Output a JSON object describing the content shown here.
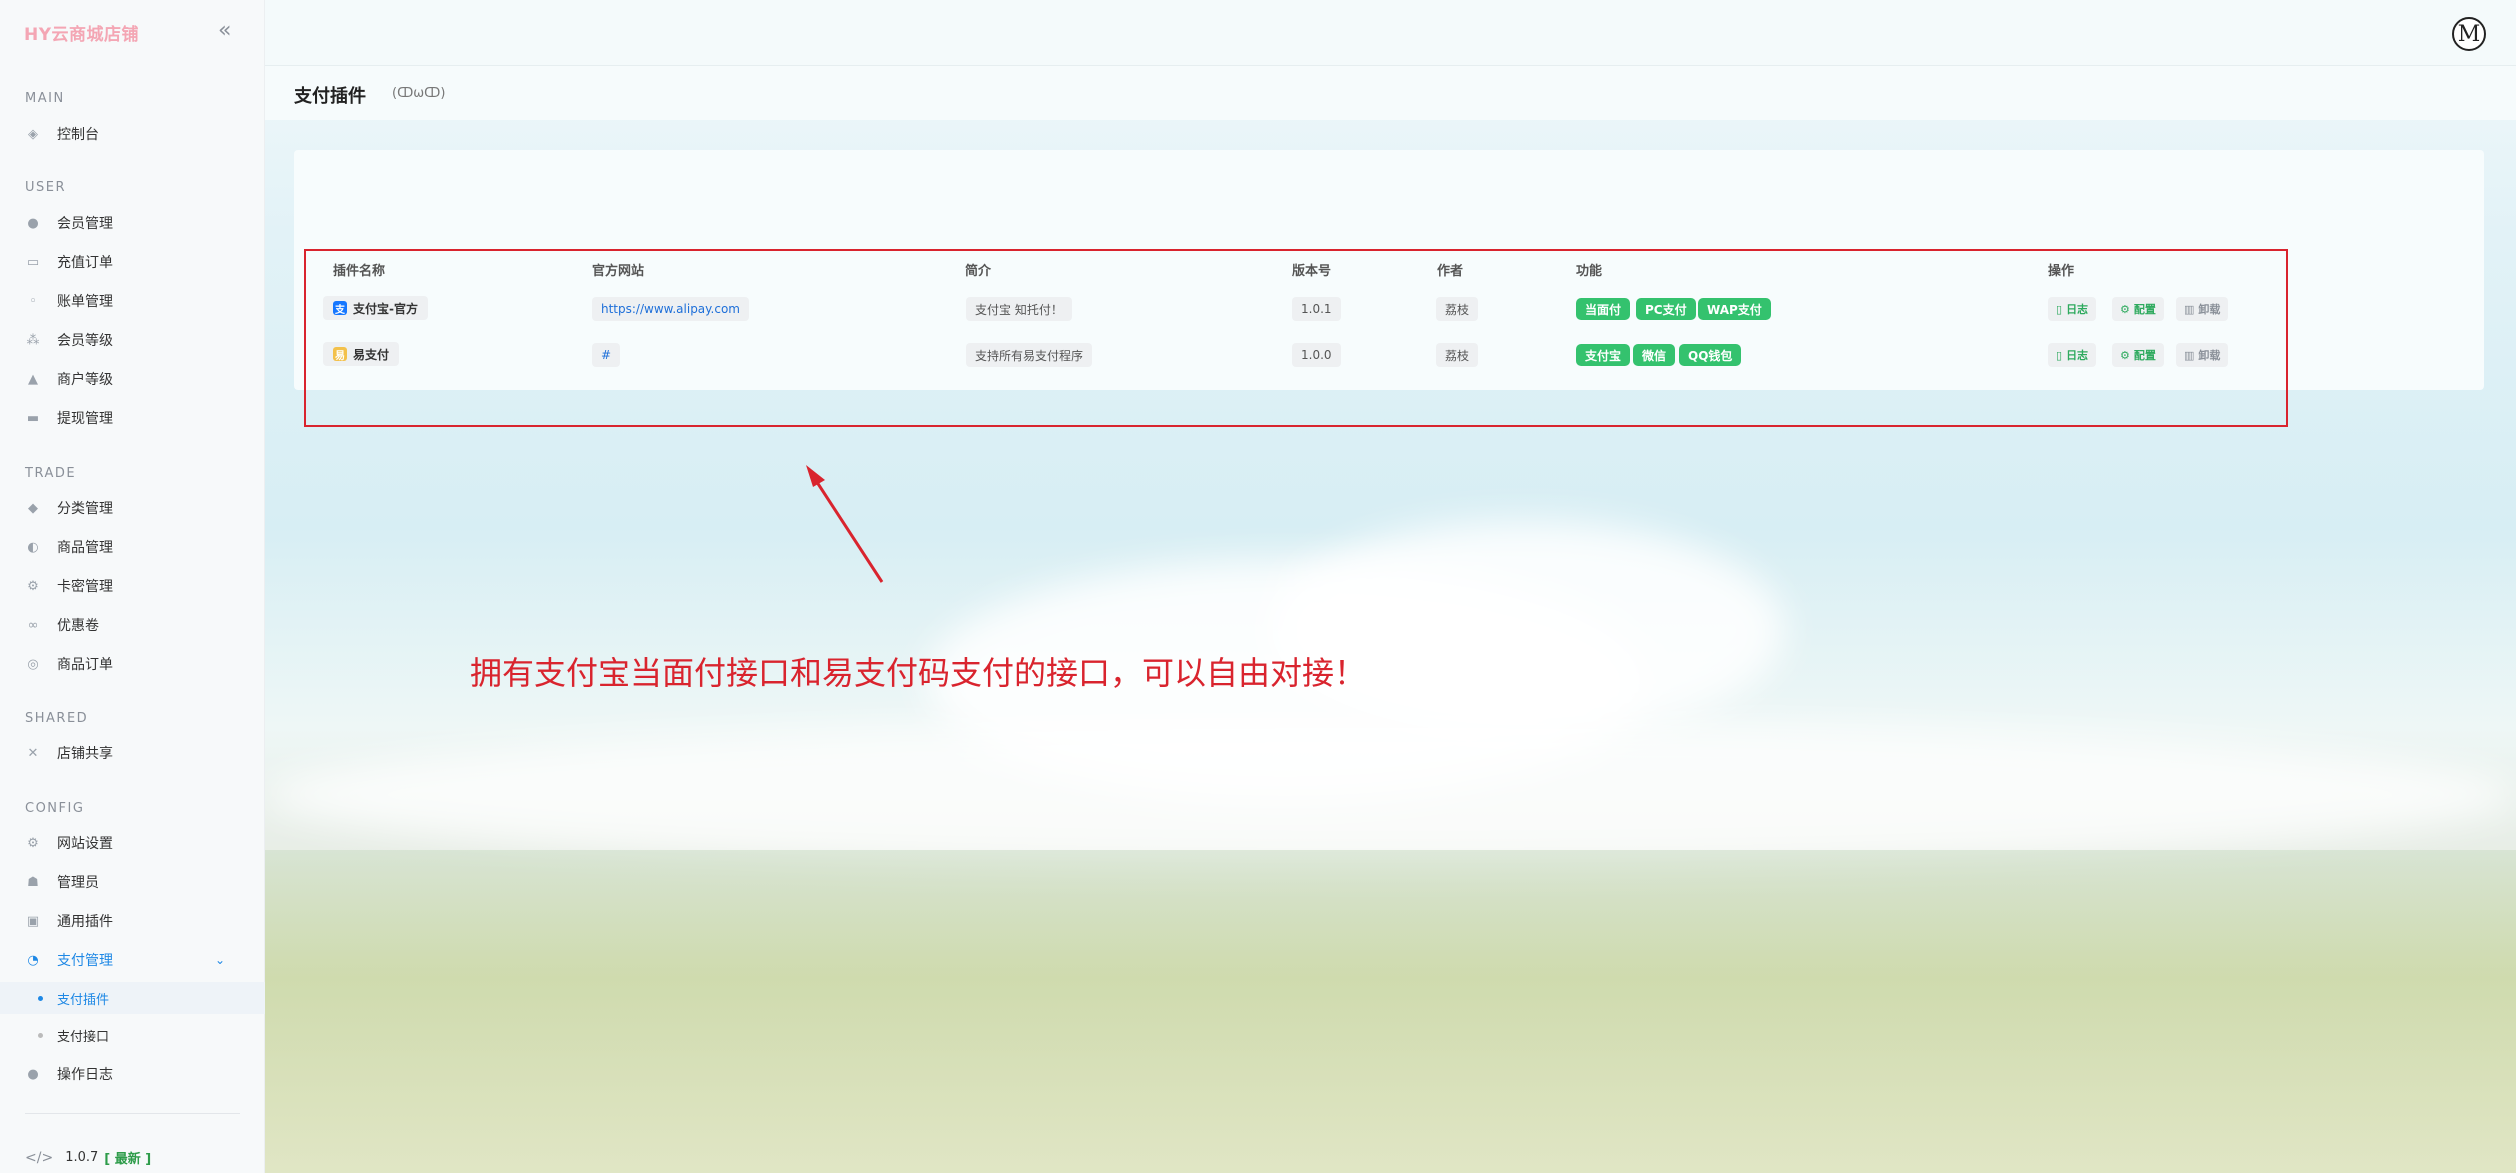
{
  "sidebar": {
    "brand": "HY云商城店铺",
    "collapse_glyph": "«",
    "sections": {
      "main": "MAIN",
      "user": "USER",
      "trade": "TRADE",
      "shared": "SHARED",
      "config": "CONFIG"
    },
    "items": {
      "dashboard": "控制台",
      "members": "会员管理",
      "recharge": "充值订单",
      "bills": "账单管理",
      "member_level": "会员等级",
      "merchant_level": "商户等级",
      "withdraw": "提现管理",
      "category": "分类管理",
      "goods": "商品管理",
      "cardkey": "卡密管理",
      "coupon": "优惠卷",
      "goods_order": "商品订单",
      "shop_share": "店铺共享",
      "site_settings": "网站设置",
      "admins": "管理员",
      "plugins": "通用插件",
      "payment": "支付管理",
      "pay_plugins": "支付插件",
      "pay_api": "支付接口",
      "op_log": "操作日志"
    },
    "version": "1.0.7",
    "version_tag": "[ 最新 ]"
  },
  "header": {
    "avatar_letter": "M",
    "page_title": "支付插件",
    "page_emote": "(ↀωↀ)"
  },
  "table": {
    "columns": {
      "name": "插件名称",
      "site": "官方网站",
      "intro": "简介",
      "version": "版本号",
      "author": "作者",
      "features": "功能",
      "actions": "操作"
    },
    "rows": [
      {
        "name": "支付宝-官方",
        "site": "https://www.alipay.com",
        "intro": "支付宝 知托付！",
        "version": "1.0.1",
        "author": "荔枝",
        "features": [
          "当面付",
          "PC支付",
          "WAP支付"
        ],
        "action_log": "日志",
        "action_cfg": "配置",
        "action_del": "卸载"
      },
      {
        "name": "易支付",
        "site": "#",
        "intro": "支持所有易支付程序",
        "version": "1.0.0",
        "author": "荔枝",
        "features": [
          "支付宝",
          "微信",
          "QQ钱包"
        ],
        "action_log": "日志",
        "action_cfg": "配置",
        "action_del": "卸载"
      }
    ]
  },
  "annotation": {
    "text": "拥有支付宝当面付接口和易支付码支付的接口，可以自由对接！",
    "color": "#d9242e"
  },
  "colors": {
    "accent": "#1e88e5",
    "feature_green": "#34c26e",
    "brand_pink": "#f4a6b4"
  }
}
